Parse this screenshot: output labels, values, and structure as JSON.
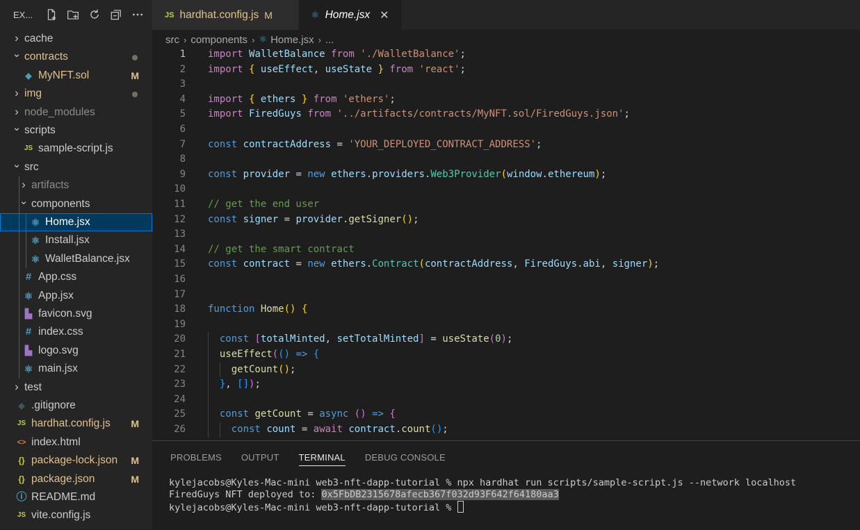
{
  "sidebar": {
    "title": "EX...",
    "actions": [
      "new-file-icon",
      "new-folder-icon",
      "refresh-icon",
      "collapse-all-icon",
      "more-icon"
    ],
    "items": [
      {
        "label": "cache",
        "type": "folder",
        "expanded": false,
        "depth": 0,
        "color": "#cccccc"
      },
      {
        "label": "contracts",
        "type": "folder",
        "expanded": true,
        "depth": 0,
        "color": "#e2c08d",
        "decoration": "dot"
      },
      {
        "label": "MyNFT.sol",
        "type": "file",
        "icon": "solidity-icon",
        "depth": 1,
        "color": "#e2c08d",
        "badge": "M"
      },
      {
        "label": "img",
        "type": "folder",
        "expanded": false,
        "depth": 0,
        "color": "#e2c08d",
        "decoration": "dot"
      },
      {
        "label": "node_modules",
        "type": "folder",
        "expanded": false,
        "depth": 0,
        "color": "#8c8c8c"
      },
      {
        "label": "scripts",
        "type": "folder",
        "expanded": true,
        "depth": 0,
        "color": "#cccccc"
      },
      {
        "label": "sample-script.js",
        "type": "file",
        "icon": "js-icon",
        "depth": 1,
        "color": "#cccccc"
      },
      {
        "label": "src",
        "type": "folder",
        "expanded": true,
        "depth": 0,
        "color": "#cccccc"
      },
      {
        "label": "artifacts",
        "type": "folder",
        "expanded": false,
        "depth": 1,
        "color": "#8c8c8c"
      },
      {
        "label": "components",
        "type": "folder",
        "expanded": true,
        "depth": 1,
        "color": "#cccccc"
      },
      {
        "label": "Home.jsx",
        "type": "file",
        "icon": "react-icon",
        "depth": 2,
        "color": "#ffffff",
        "selected": true
      },
      {
        "label": "Install.jsx",
        "type": "file",
        "icon": "react-icon",
        "depth": 2,
        "color": "#cccccc"
      },
      {
        "label": "WalletBalance.jsx",
        "type": "file",
        "icon": "react-icon",
        "depth": 2,
        "color": "#cccccc"
      },
      {
        "label": "App.css",
        "type": "file",
        "icon": "css-icon",
        "depth": 1,
        "color": "#cccccc"
      },
      {
        "label": "App.jsx",
        "type": "file",
        "icon": "react-icon",
        "depth": 1,
        "color": "#cccccc"
      },
      {
        "label": "favicon.svg",
        "type": "file",
        "icon": "svg-icon",
        "depth": 1,
        "color": "#cccccc"
      },
      {
        "label": "index.css",
        "type": "file",
        "icon": "css-icon",
        "depth": 1,
        "color": "#cccccc"
      },
      {
        "label": "logo.svg",
        "type": "file",
        "icon": "svg-icon",
        "depth": 1,
        "color": "#cccccc"
      },
      {
        "label": "main.jsx",
        "type": "file",
        "icon": "react-icon",
        "depth": 1,
        "color": "#cccccc"
      },
      {
        "label": "test",
        "type": "folder",
        "expanded": false,
        "depth": 0,
        "color": "#cccccc"
      },
      {
        "label": ".gitignore",
        "type": "file",
        "icon": "git-icon",
        "depth": 0,
        "color": "#cccccc"
      },
      {
        "label": "hardhat.config.js",
        "type": "file",
        "icon": "js-icon",
        "depth": 0,
        "color": "#e2c08d",
        "badge": "M"
      },
      {
        "label": "index.html",
        "type": "file",
        "icon": "html-icon",
        "depth": 0,
        "color": "#cccccc"
      },
      {
        "label": "package-lock.json",
        "type": "file",
        "icon": "json-icon",
        "depth": 0,
        "color": "#e2c08d",
        "badge": "M"
      },
      {
        "label": "package.json",
        "type": "file",
        "icon": "json-icon",
        "depth": 0,
        "color": "#e2c08d",
        "badge": "M"
      },
      {
        "label": "README.md",
        "type": "file",
        "icon": "info-icon",
        "depth": 0,
        "color": "#cccccc"
      },
      {
        "label": "vite.config.js",
        "type": "file",
        "icon": "js-icon",
        "depth": 0,
        "color": "#cccccc"
      }
    ]
  },
  "tabs": [
    {
      "label": "hardhat.config.js",
      "icon": "JS",
      "badge": "M",
      "active": false
    },
    {
      "label": "Home.jsx",
      "icon": "react-icon",
      "active": true
    }
  ],
  "breadcrumb": {
    "parts": [
      "src",
      "components",
      "Home.jsx",
      "..."
    ]
  },
  "editor": {
    "active_line": 1,
    "lines": [
      [
        [
          "k",
          "import"
        ],
        [
          "t",
          " "
        ],
        [
          "v",
          "WalletBalance"
        ],
        [
          "t",
          " "
        ],
        [
          "k",
          "from"
        ],
        [
          "t",
          " "
        ],
        [
          "s",
          "'./WalletBalance'"
        ],
        [
          "t",
          ";"
        ]
      ],
      [
        [
          "k",
          "import"
        ],
        [
          "t",
          " "
        ],
        [
          "b1",
          "{"
        ],
        [
          "t",
          " "
        ],
        [
          "v",
          "useEffect"
        ],
        [
          "t",
          ", "
        ],
        [
          "v",
          "useState"
        ],
        [
          "t",
          " "
        ],
        [
          "b1",
          "}"
        ],
        [
          "t",
          " "
        ],
        [
          "k",
          "from"
        ],
        [
          "t",
          " "
        ],
        [
          "s",
          "'react'"
        ],
        [
          "t",
          ";"
        ]
      ],
      [],
      [
        [
          "k",
          "import"
        ],
        [
          "t",
          " "
        ],
        [
          "b1",
          "{"
        ],
        [
          "t",
          " "
        ],
        [
          "v",
          "ethers"
        ],
        [
          "t",
          " "
        ],
        [
          "b1",
          "}"
        ],
        [
          "t",
          " "
        ],
        [
          "k",
          "from"
        ],
        [
          "t",
          " "
        ],
        [
          "s",
          "'ethers'"
        ],
        [
          "t",
          ";"
        ]
      ],
      [
        [
          "k",
          "import"
        ],
        [
          "t",
          " "
        ],
        [
          "v",
          "FiredGuys"
        ],
        [
          "t",
          " "
        ],
        [
          "k",
          "from"
        ],
        [
          "t",
          " "
        ],
        [
          "s",
          "'../artifacts/contracts/MyNFT.sol/FiredGuys.json'"
        ],
        [
          "t",
          ";"
        ]
      ],
      [],
      [
        [
          "kb",
          "const"
        ],
        [
          "t",
          " "
        ],
        [
          "v",
          "contractAddress"
        ],
        [
          "t",
          " = "
        ],
        [
          "s",
          "'YOUR_DEPLOYED_CONTRACT_ADDRESS'"
        ],
        [
          "t",
          ";"
        ]
      ],
      [],
      [
        [
          "kb",
          "const"
        ],
        [
          "t",
          " "
        ],
        [
          "v",
          "provider"
        ],
        [
          "t",
          " = "
        ],
        [
          "kb",
          "new"
        ],
        [
          "t",
          " "
        ],
        [
          "v",
          "ethers"
        ],
        [
          "t",
          "."
        ],
        [
          "v",
          "providers"
        ],
        [
          "t",
          "."
        ],
        [
          "c",
          "Web3Provider"
        ],
        [
          "b1",
          "("
        ],
        [
          "v",
          "window"
        ],
        [
          "t",
          "."
        ],
        [
          "v",
          "ethereum"
        ],
        [
          "b1",
          ")"
        ],
        [
          "t",
          ";"
        ]
      ],
      [],
      [
        [
          "cm",
          "// get the end user"
        ]
      ],
      [
        [
          "kb",
          "const"
        ],
        [
          "t",
          " "
        ],
        [
          "v",
          "signer"
        ],
        [
          "t",
          " = "
        ],
        [
          "v",
          "provider"
        ],
        [
          "t",
          "."
        ],
        [
          "f",
          "getSigner"
        ],
        [
          "b1",
          "()"
        ],
        [
          "t",
          ";"
        ]
      ],
      [],
      [
        [
          "cm",
          "// get the smart contract"
        ]
      ],
      [
        [
          "kb",
          "const"
        ],
        [
          "t",
          " "
        ],
        [
          "v",
          "contract"
        ],
        [
          "t",
          " = "
        ],
        [
          "kb",
          "new"
        ],
        [
          "t",
          " "
        ],
        [
          "v",
          "ethers"
        ],
        [
          "t",
          "."
        ],
        [
          "c",
          "Contract"
        ],
        [
          "b1",
          "("
        ],
        [
          "v",
          "contractAddress"
        ],
        [
          "t",
          ", "
        ],
        [
          "v",
          "FiredGuys"
        ],
        [
          "t",
          "."
        ],
        [
          "v",
          "abi"
        ],
        [
          "t",
          ", "
        ],
        [
          "v",
          "signer"
        ],
        [
          "b1",
          ")"
        ],
        [
          "t",
          ";"
        ]
      ],
      [],
      [],
      [
        [
          "kb",
          "function"
        ],
        [
          "t",
          " "
        ],
        [
          "f",
          "Home"
        ],
        [
          "b1",
          "()"
        ],
        [
          "t",
          " "
        ],
        [
          "b1",
          "{"
        ]
      ],
      [],
      [
        [
          "t",
          "  "
        ],
        [
          "kb",
          "const"
        ],
        [
          "t",
          " "
        ],
        [
          "b2",
          "["
        ],
        [
          "v",
          "totalMinted"
        ],
        [
          "t",
          ", "
        ],
        [
          "v",
          "setTotalMinted"
        ],
        [
          "b2",
          "]"
        ],
        [
          "t",
          " = "
        ],
        [
          "f",
          "useState"
        ],
        [
          "b2",
          "("
        ],
        [
          "n",
          "0"
        ],
        [
          "b2",
          ")"
        ],
        [
          "t",
          ";"
        ]
      ],
      [
        [
          "t",
          "  "
        ],
        [
          "f",
          "useEffect"
        ],
        [
          "b2",
          "("
        ],
        [
          "b3",
          "()"
        ],
        [
          "t",
          " "
        ],
        [
          "kb",
          "=>"
        ],
        [
          "t",
          " "
        ],
        [
          "b3",
          "{"
        ]
      ],
      [
        [
          "t",
          "    "
        ],
        [
          "f",
          "getCount"
        ],
        [
          "b1",
          "()"
        ],
        [
          "t",
          ";"
        ]
      ],
      [
        [
          "t",
          "  "
        ],
        [
          "b3",
          "}"
        ],
        [
          "t",
          ", "
        ],
        [
          "b3",
          "[]"
        ],
        [
          "b2",
          ")"
        ],
        [
          "t",
          ";"
        ]
      ],
      [],
      [
        [
          "t",
          "  "
        ],
        [
          "kb",
          "const"
        ],
        [
          "t",
          " "
        ],
        [
          "f",
          "getCount"
        ],
        [
          "t",
          " = "
        ],
        [
          "kb",
          "async"
        ],
        [
          "t",
          " "
        ],
        [
          "b2",
          "()"
        ],
        [
          "t",
          " "
        ],
        [
          "kb",
          "=>"
        ],
        [
          "t",
          " "
        ],
        [
          "b2",
          "{"
        ]
      ],
      [
        [
          "t",
          "    "
        ],
        [
          "kb",
          "const"
        ],
        [
          "t",
          " "
        ],
        [
          "v",
          "count"
        ],
        [
          "t",
          " = "
        ],
        [
          "k",
          "await"
        ],
        [
          "t",
          " "
        ],
        [
          "v",
          "contract"
        ],
        [
          "t",
          "."
        ],
        [
          "f",
          "count"
        ],
        [
          "b3",
          "()"
        ],
        [
          "t",
          ";"
        ]
      ]
    ]
  },
  "panel": {
    "tabs": [
      "PROBLEMS",
      "OUTPUT",
      "TERMINAL",
      "DEBUG CONSOLE"
    ],
    "active_tab": "TERMINAL",
    "terminal": {
      "line1": "kylejacobs@Kyles-Mac-mini web3-nft-dapp-tutorial % npx hardhat run scripts/sample-script.js --network localhost",
      "line2_prefix": "FiredGuys NFT deployed to: ",
      "line2_address": "0x5FbDB2315678afecb367f032d93F642f64180aa3",
      "line3": "kylejacobs@Kyles-Mac-mini web3-nft-dapp-tutorial % "
    }
  }
}
